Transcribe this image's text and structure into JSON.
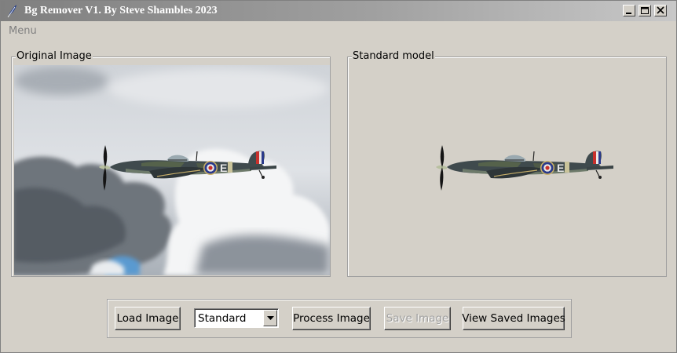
{
  "window": {
    "title": "Bg Remover V1. By Steve Shambles 2023",
    "icon": "feather-icon"
  },
  "menubar": {
    "menu_label": "Menu"
  },
  "panels": {
    "original_label": "Original Image",
    "processed_label": "Standard model"
  },
  "controls": {
    "load_label": "Load Image",
    "model_select_value": "Standard",
    "process_label": "Process Image",
    "save_label": "Save Image",
    "view_saved_label": "View Saved Images"
  }
}
